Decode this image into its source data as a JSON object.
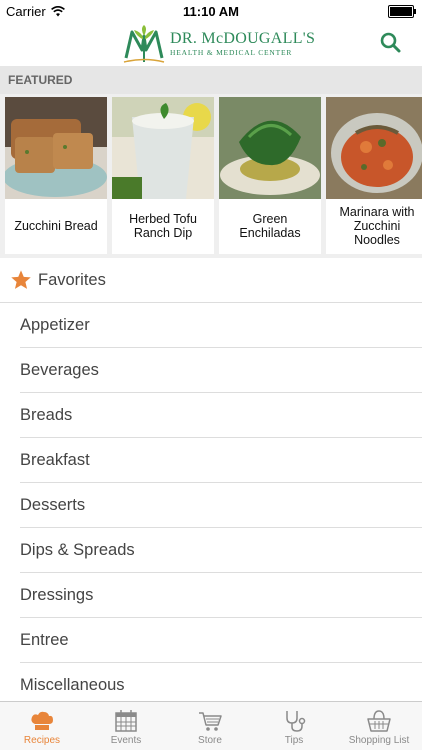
{
  "status": {
    "carrier": "Carrier",
    "time": "11:10 AM"
  },
  "header": {
    "brand": "DR. McDOUGALL'S",
    "subtitle": "HEALTH & MEDICAL CENTER"
  },
  "featured": {
    "label": "FEATURED",
    "items": [
      {
        "title": "Zucchini Bread"
      },
      {
        "title": "Herbed Tofu Ranch Dip"
      },
      {
        "title": "Green Enchiladas"
      },
      {
        "title": "Marinara with Zucchini Noodles"
      }
    ]
  },
  "categories": {
    "favorites": "Favorites",
    "items": [
      "Appetizer",
      "Beverages",
      "Breads",
      "Breakfast",
      "Desserts",
      "Dips & Spreads",
      "Dressings",
      "Entree",
      "Miscellaneous"
    ]
  },
  "tabs": [
    {
      "label": "Recipes",
      "icon": "chef-hat-icon",
      "active": true
    },
    {
      "label": "Events",
      "icon": "calendar-icon"
    },
    {
      "label": "Store",
      "icon": "cart-icon"
    },
    {
      "label": "Tips",
      "icon": "stethoscope-icon"
    },
    {
      "label": "Shopping List",
      "icon": "basket-icon"
    }
  ],
  "colors": {
    "accent": "#e8853a",
    "brand": "#2e8a5a"
  }
}
